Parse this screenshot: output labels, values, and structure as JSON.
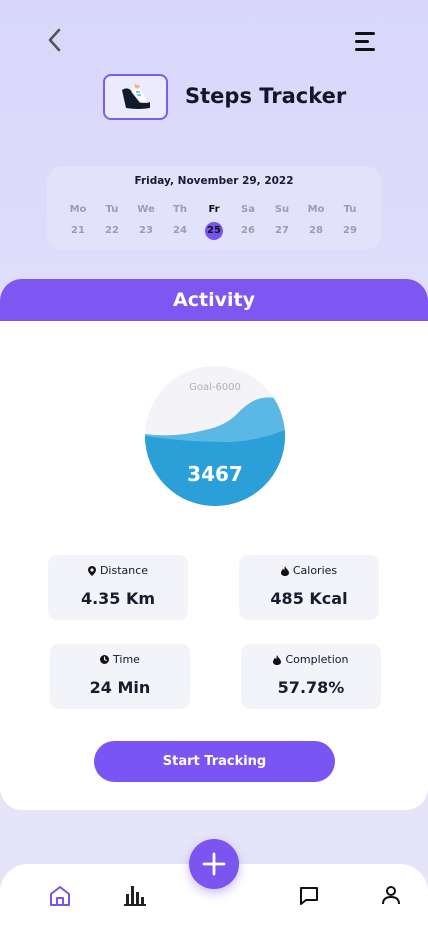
{
  "header": {
    "title": "Steps Tracker",
    "back_icon": "chevron-left-icon",
    "menu_icon": "menu-icon"
  },
  "calendar": {
    "date_label": "Friday, November 29, 2022",
    "days": [
      {
        "day": "Mo",
        "num": "21"
      },
      {
        "day": "Tu",
        "num": "22"
      },
      {
        "day": "We",
        "num": "23"
      },
      {
        "day": "Th",
        "num": "24"
      },
      {
        "day": "Fr",
        "num": "25"
      },
      {
        "day": "Sa",
        "num": "26"
      },
      {
        "day": "Su",
        "num": "27"
      },
      {
        "day": "Mo",
        "num": "28"
      },
      {
        "day": "Tu",
        "num": "29"
      }
    ],
    "selected_index": 4
  },
  "activity": {
    "title": "Activity",
    "goal_label": "Goal-6000",
    "steps": "3467",
    "progress_fraction": 0.5778
  },
  "stats": {
    "distance": {
      "label": "Distance",
      "value": "4.35 Km",
      "icon": "location-pin-icon"
    },
    "calories": {
      "label": "Calories",
      "value": "485 Kcal",
      "icon": "flame-icon"
    },
    "time": {
      "label": "Time",
      "value": "24 Min",
      "icon": "clock-icon"
    },
    "completion": {
      "label": "Completion",
      "value": "57.78%",
      "icon": "flame-icon"
    }
  },
  "start_button": "Start Tracking",
  "nav": {
    "items": [
      "home-icon",
      "stats-icon",
      "chat-icon",
      "profile-icon"
    ],
    "fab_icon": "plus-icon"
  },
  "colors": {
    "accent": "#7b55f3",
    "water": "#2ba0d8",
    "water_light": "#5bb8e4",
    "background": "#dcdbfa"
  }
}
